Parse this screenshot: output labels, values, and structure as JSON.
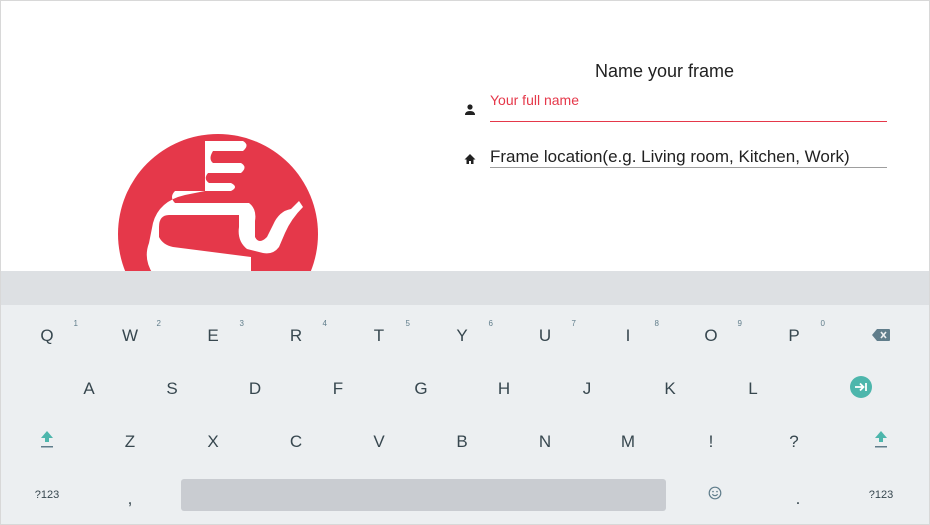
{
  "form": {
    "title": "Name your frame",
    "name_field": {
      "label": "Your full name",
      "icon": "person-icon"
    },
    "location_field": {
      "label": "Frame location(e.g. Living room, Kitchen, Work)",
      "icon": "home-icon"
    }
  },
  "colors": {
    "accent": "#e5384a",
    "keyboard_bg": "#eceff1",
    "keyboard_strip": "#dde0e3",
    "teal": "#4db6ac"
  },
  "keyboard": {
    "row1": [
      {
        "label": "Q",
        "hint": "1"
      },
      {
        "label": "W",
        "hint": "2"
      },
      {
        "label": "E",
        "hint": "3"
      },
      {
        "label": "R",
        "hint": "4"
      },
      {
        "label": "T",
        "hint": "5"
      },
      {
        "label": "Y",
        "hint": "6"
      },
      {
        "label": "U",
        "hint": "7"
      },
      {
        "label": "I",
        "hint": "8"
      },
      {
        "label": "O",
        "hint": "9"
      },
      {
        "label": "P",
        "hint": "0"
      }
    ],
    "row2": [
      "A",
      "S",
      "D",
      "F",
      "G",
      "H",
      "J",
      "K",
      "L"
    ],
    "row3": [
      "Z",
      "X",
      "C",
      "V",
      "B",
      "N",
      "M",
      "!",
      "?"
    ],
    "row4": {
      "symbols_left": "?123",
      "comma": ",",
      "period": ".",
      "symbols_right": "?123"
    },
    "icons": {
      "backspace": "backspace-icon",
      "next": "tab-next-icon",
      "shift": "shift-icon",
      "emoji": "emoji-icon"
    }
  }
}
